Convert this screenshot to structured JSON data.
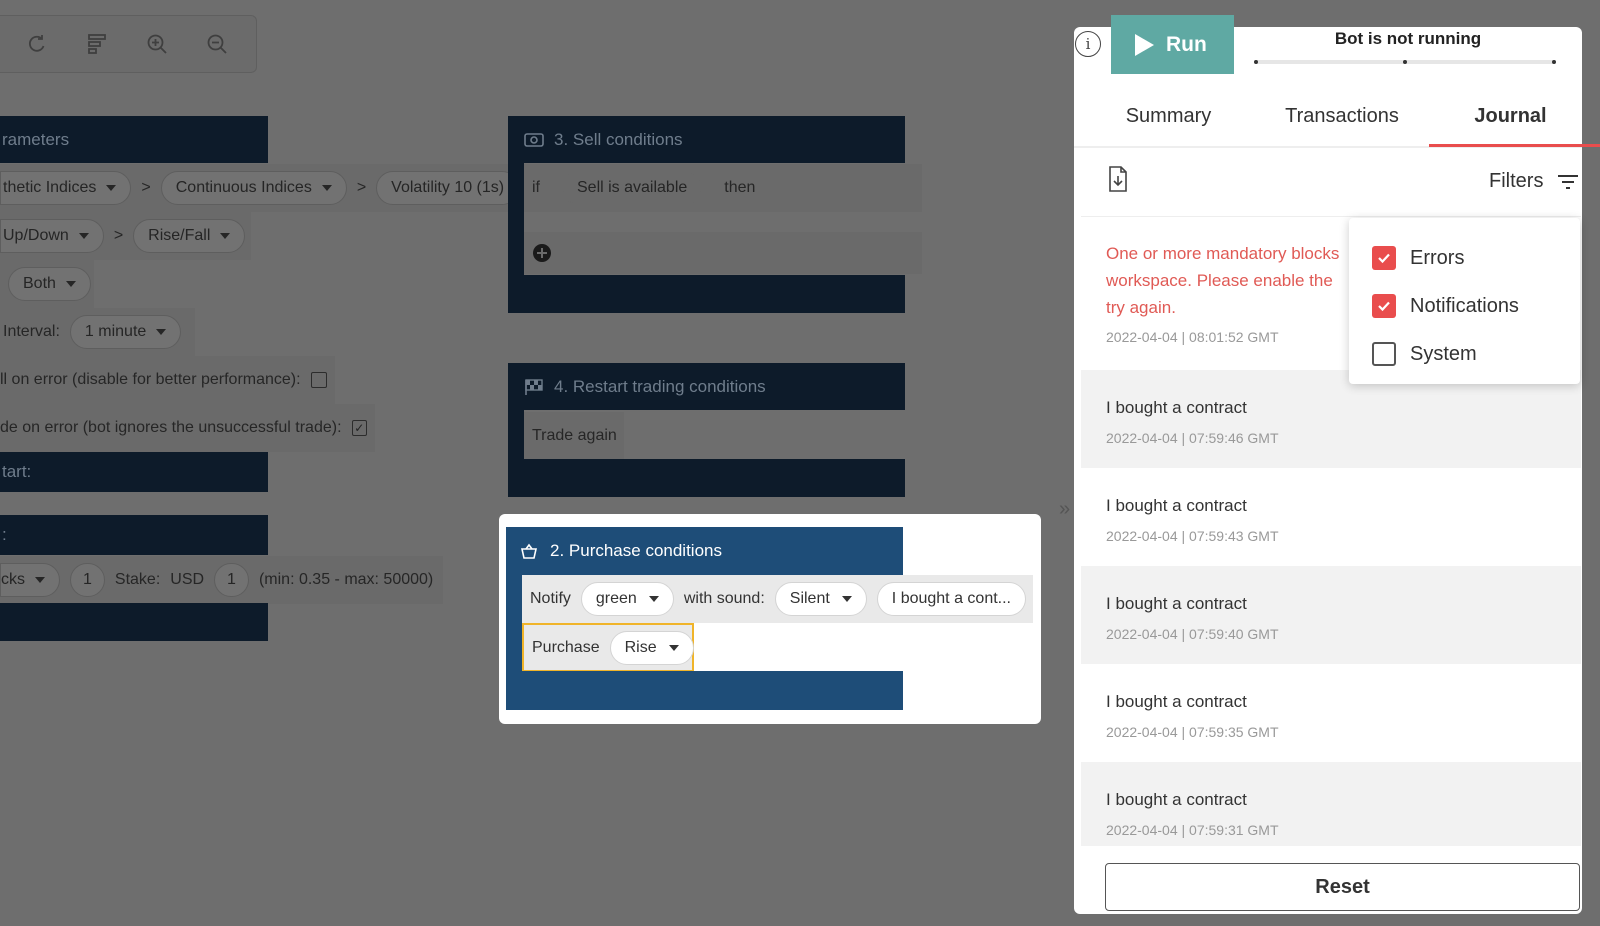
{
  "toolbar": {
    "icons": [
      "redo-icon",
      "sort-icon",
      "zoom-in-icon",
      "zoom-out-icon"
    ]
  },
  "trade_parameters": {
    "header": "rameters",
    "market": [
      "thetic Indices",
      "Continuous Indices",
      "Volatility 10 (1s)"
    ],
    "trade_type": [
      "Up/Down",
      "Rise/Fall"
    ],
    "contract_type": "Both",
    "interval_label": "Interval:",
    "interval_value": "1 minute",
    "restart_on_error": "ll on error (disable for better performance):",
    "restart_last_trade": "de on error (bot ignores the unsuccessful trade):",
    "run_once_label": "tart:",
    "trade_options_label": ":",
    "duration_unit": "cks",
    "duration_value": "1",
    "stake_label": "Stake:",
    "currency": "USD",
    "stake_value": "1",
    "stake_range": "(min: 0.35 - max: 50000)"
  },
  "sell_conditions": {
    "title": "3. Sell conditions",
    "if": "if",
    "condition": "Sell is available",
    "then": "then"
  },
  "restart_conditions": {
    "title": "4. Restart trading conditions",
    "action": "Trade again"
  },
  "purchase_conditions": {
    "title": "2. Purchase conditions",
    "notify_label": "Notify",
    "notify_color": "green",
    "sound_label": "with sound:",
    "sound_value": "Silent",
    "message": "I bought a cont...",
    "purchase_label": "Purchase",
    "purchase_value": "Rise"
  },
  "run_panel": {
    "run_label": "Run",
    "status": "Bot is not running",
    "tabs": [
      "Summary",
      "Transactions",
      "Journal"
    ],
    "active_tab": "Journal",
    "filters_label": "Filters",
    "filter_options": [
      {
        "label": "Errors",
        "checked": true
      },
      {
        "label": "Notifications",
        "checked": true
      },
      {
        "label": "System",
        "checked": false
      }
    ],
    "error_entry": {
      "line1": "One or more mandatory blocks",
      "line2": "workspace. Please enable the",
      "line3": "try again.",
      "time": "2022-04-04 | 08:01:52 GMT"
    },
    "entries": [
      {
        "message": "I bought a contract",
        "time": "2022-04-04 | 07:59:46 GMT"
      },
      {
        "message": "I bought a contract",
        "time": "2022-04-04 | 07:59:43 GMT"
      },
      {
        "message": "I bought a contract",
        "time": "2022-04-04 | 07:59:40 GMT"
      },
      {
        "message": "I bought a contract",
        "time": "2022-04-04 | 07:59:35 GMT"
      },
      {
        "message": "I bought a contract",
        "time": "2022-04-04 | 07:59:31 GMT"
      }
    ],
    "reset_label": "Reset"
  },
  "colors": {
    "accent": "#e94d4d",
    "run_button": "#5fa9a3",
    "block_header": "#1e4d78",
    "error_text": "#e05a55"
  }
}
